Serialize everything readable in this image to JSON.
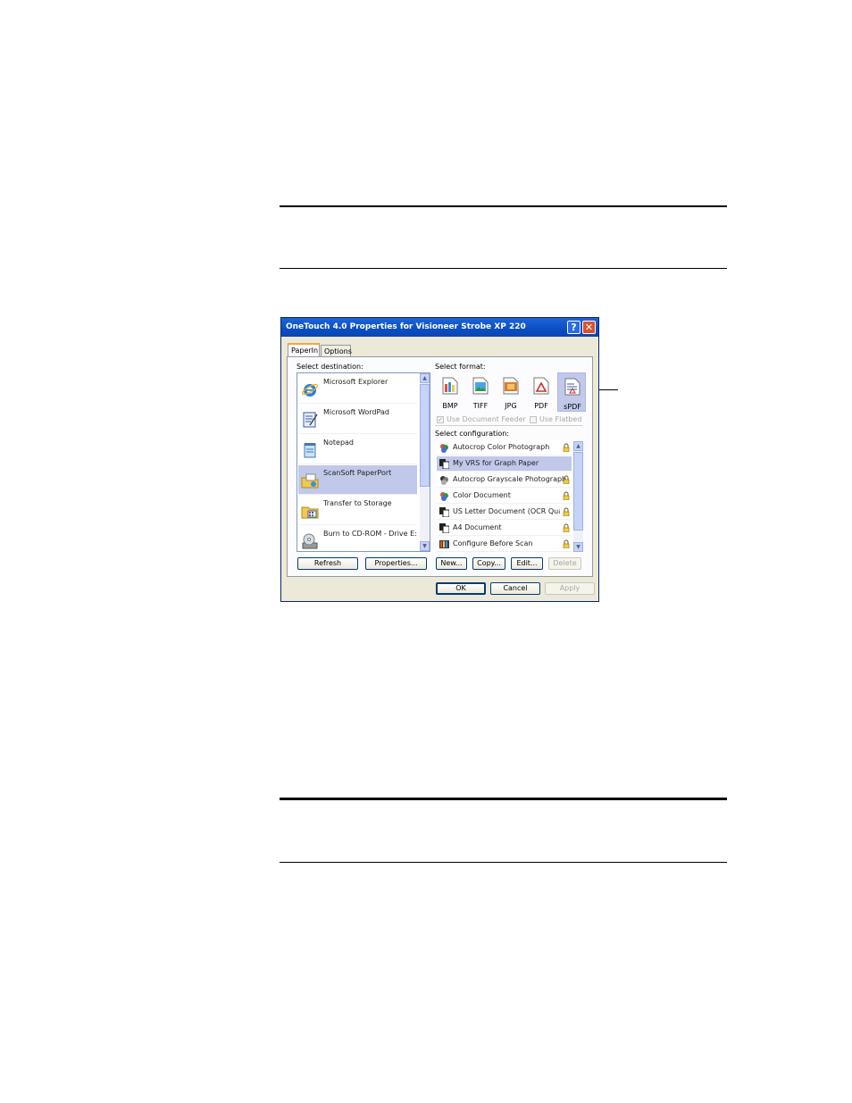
{
  "dialog": {
    "title": "OneTouch 4.0 Properties for Visioneer Strobe XP 220",
    "help_label": "?",
    "close_label": "✕",
    "tabs": [
      {
        "label": "PaperIn",
        "active": true
      },
      {
        "label": "Options",
        "active": false
      }
    ],
    "destination": {
      "label": "Select destination:",
      "items": [
        {
          "label": "Microsoft Explorer",
          "icon": "internet-explorer-icon",
          "selected": false
        },
        {
          "label": "Microsoft WordPad",
          "icon": "wordpad-icon",
          "selected": false
        },
        {
          "label": "Notepad",
          "icon": "notepad-icon",
          "selected": false
        },
        {
          "label": "ScanSoft PaperPort",
          "icon": "paperport-folder-icon",
          "selected": true
        },
        {
          "label": "Transfer to Storage",
          "icon": "storage-folder-icon",
          "selected": false
        },
        {
          "label": "Burn to CD-ROM - Drive E:",
          "icon": "cd-drive-icon",
          "selected": false
        }
      ],
      "refresh_label": "Refresh",
      "properties_label": "Properties..."
    },
    "format": {
      "label": "Select format:",
      "items": [
        {
          "label": "BMP",
          "icon": "bmp-file-icon",
          "selected": false
        },
        {
          "label": "TIFF",
          "icon": "tiff-file-icon",
          "selected": false
        },
        {
          "label": "JPG",
          "icon": "jpg-file-icon",
          "selected": false
        },
        {
          "label": "PDF",
          "icon": "pdf-file-icon",
          "selected": false
        },
        {
          "label": "sPDF",
          "icon": "spdf-file-icon",
          "selected": true
        }
      ],
      "use_document_feeder": {
        "label": "Use Document Feeder",
        "checked": true,
        "enabled": false
      },
      "use_flatbed": {
        "label": "Use Flatbed",
        "checked": false,
        "enabled": false
      }
    },
    "configuration": {
      "label": "Select configuration:",
      "items": [
        {
          "label": "Autocrop Color Photograph",
          "icon": "color-photo-icon",
          "locked": true,
          "selected": false
        },
        {
          "label": "My VRS for Graph Paper",
          "icon": "vrs-document-icon",
          "locked": false,
          "selected": true
        },
        {
          "label": "Autocrop Grayscale Photograph",
          "icon": "grayscale-photo-icon",
          "locked": true,
          "selected": false
        },
        {
          "label": "Color Document",
          "icon": "color-document-icon",
          "locked": true,
          "selected": false
        },
        {
          "label": "US Letter Document (OCR Quality)",
          "icon": "bw-document-icon",
          "locked": true,
          "selected": false
        },
        {
          "label": "A4 Document",
          "icon": "bw-document-icon",
          "locked": true,
          "selected": false
        },
        {
          "label": "Configure Before Scan",
          "icon": "configure-scan-icon",
          "locked": true,
          "selected": false
        }
      ],
      "new_label": "New...",
      "copy_label": "Copy...",
      "edit_label": "Edit...",
      "delete_label": "Delete"
    },
    "ok_label": "OK",
    "cancel_label": "Cancel",
    "apply_label": "Apply"
  },
  "colors": {
    "titlebar": "#0a4ec2",
    "selection": "#c1c8ea",
    "dialog_bg": "#ece9d8"
  }
}
